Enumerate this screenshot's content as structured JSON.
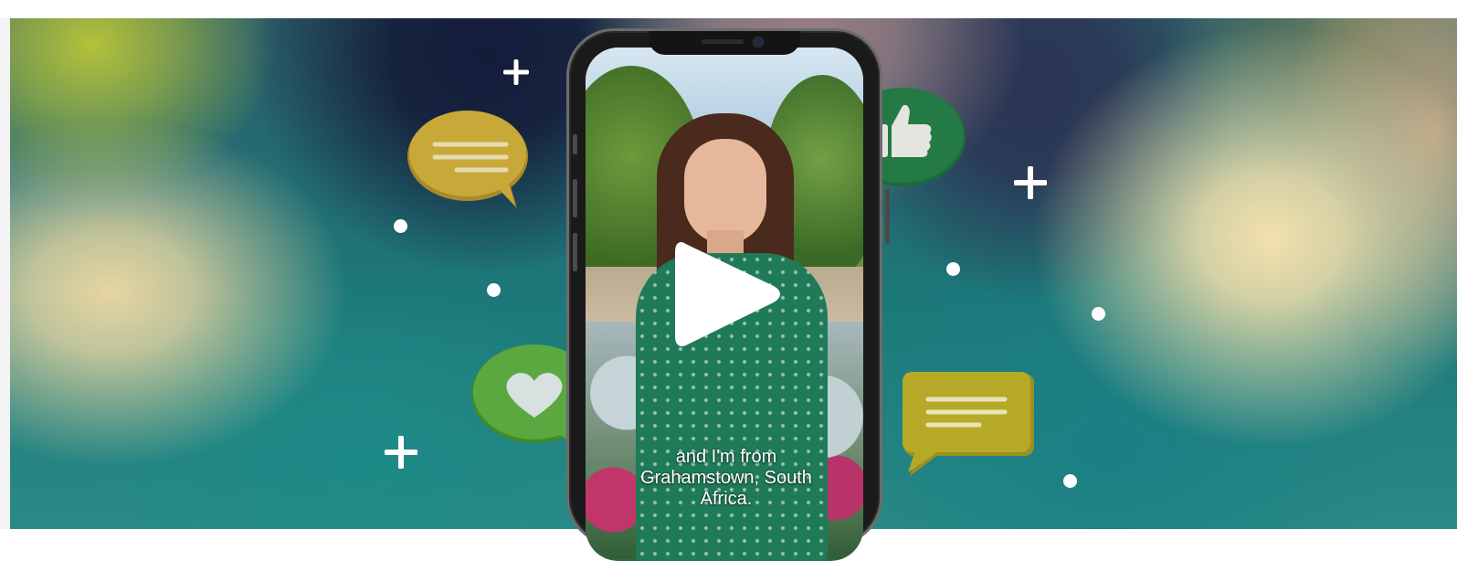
{
  "video": {
    "caption_lines": [
      "and I'm from",
      "Grahamstown, South",
      "Africa."
    ]
  },
  "icons": {
    "play": "play-icon",
    "like_bubble": "thumbs-up-icon",
    "heart_bubble": "heart-icon",
    "message_bubbles": "chat-bubble-icon",
    "sparkles": "plus-sparkle-icon"
  },
  "colors": {
    "bubble_gold": "#c9a83a",
    "bubble_green_dark": "#237a45",
    "bubble_green_light": "#5aa83f",
    "bubble_olive": "#b6a928",
    "play_fill": "#ffffff"
  }
}
